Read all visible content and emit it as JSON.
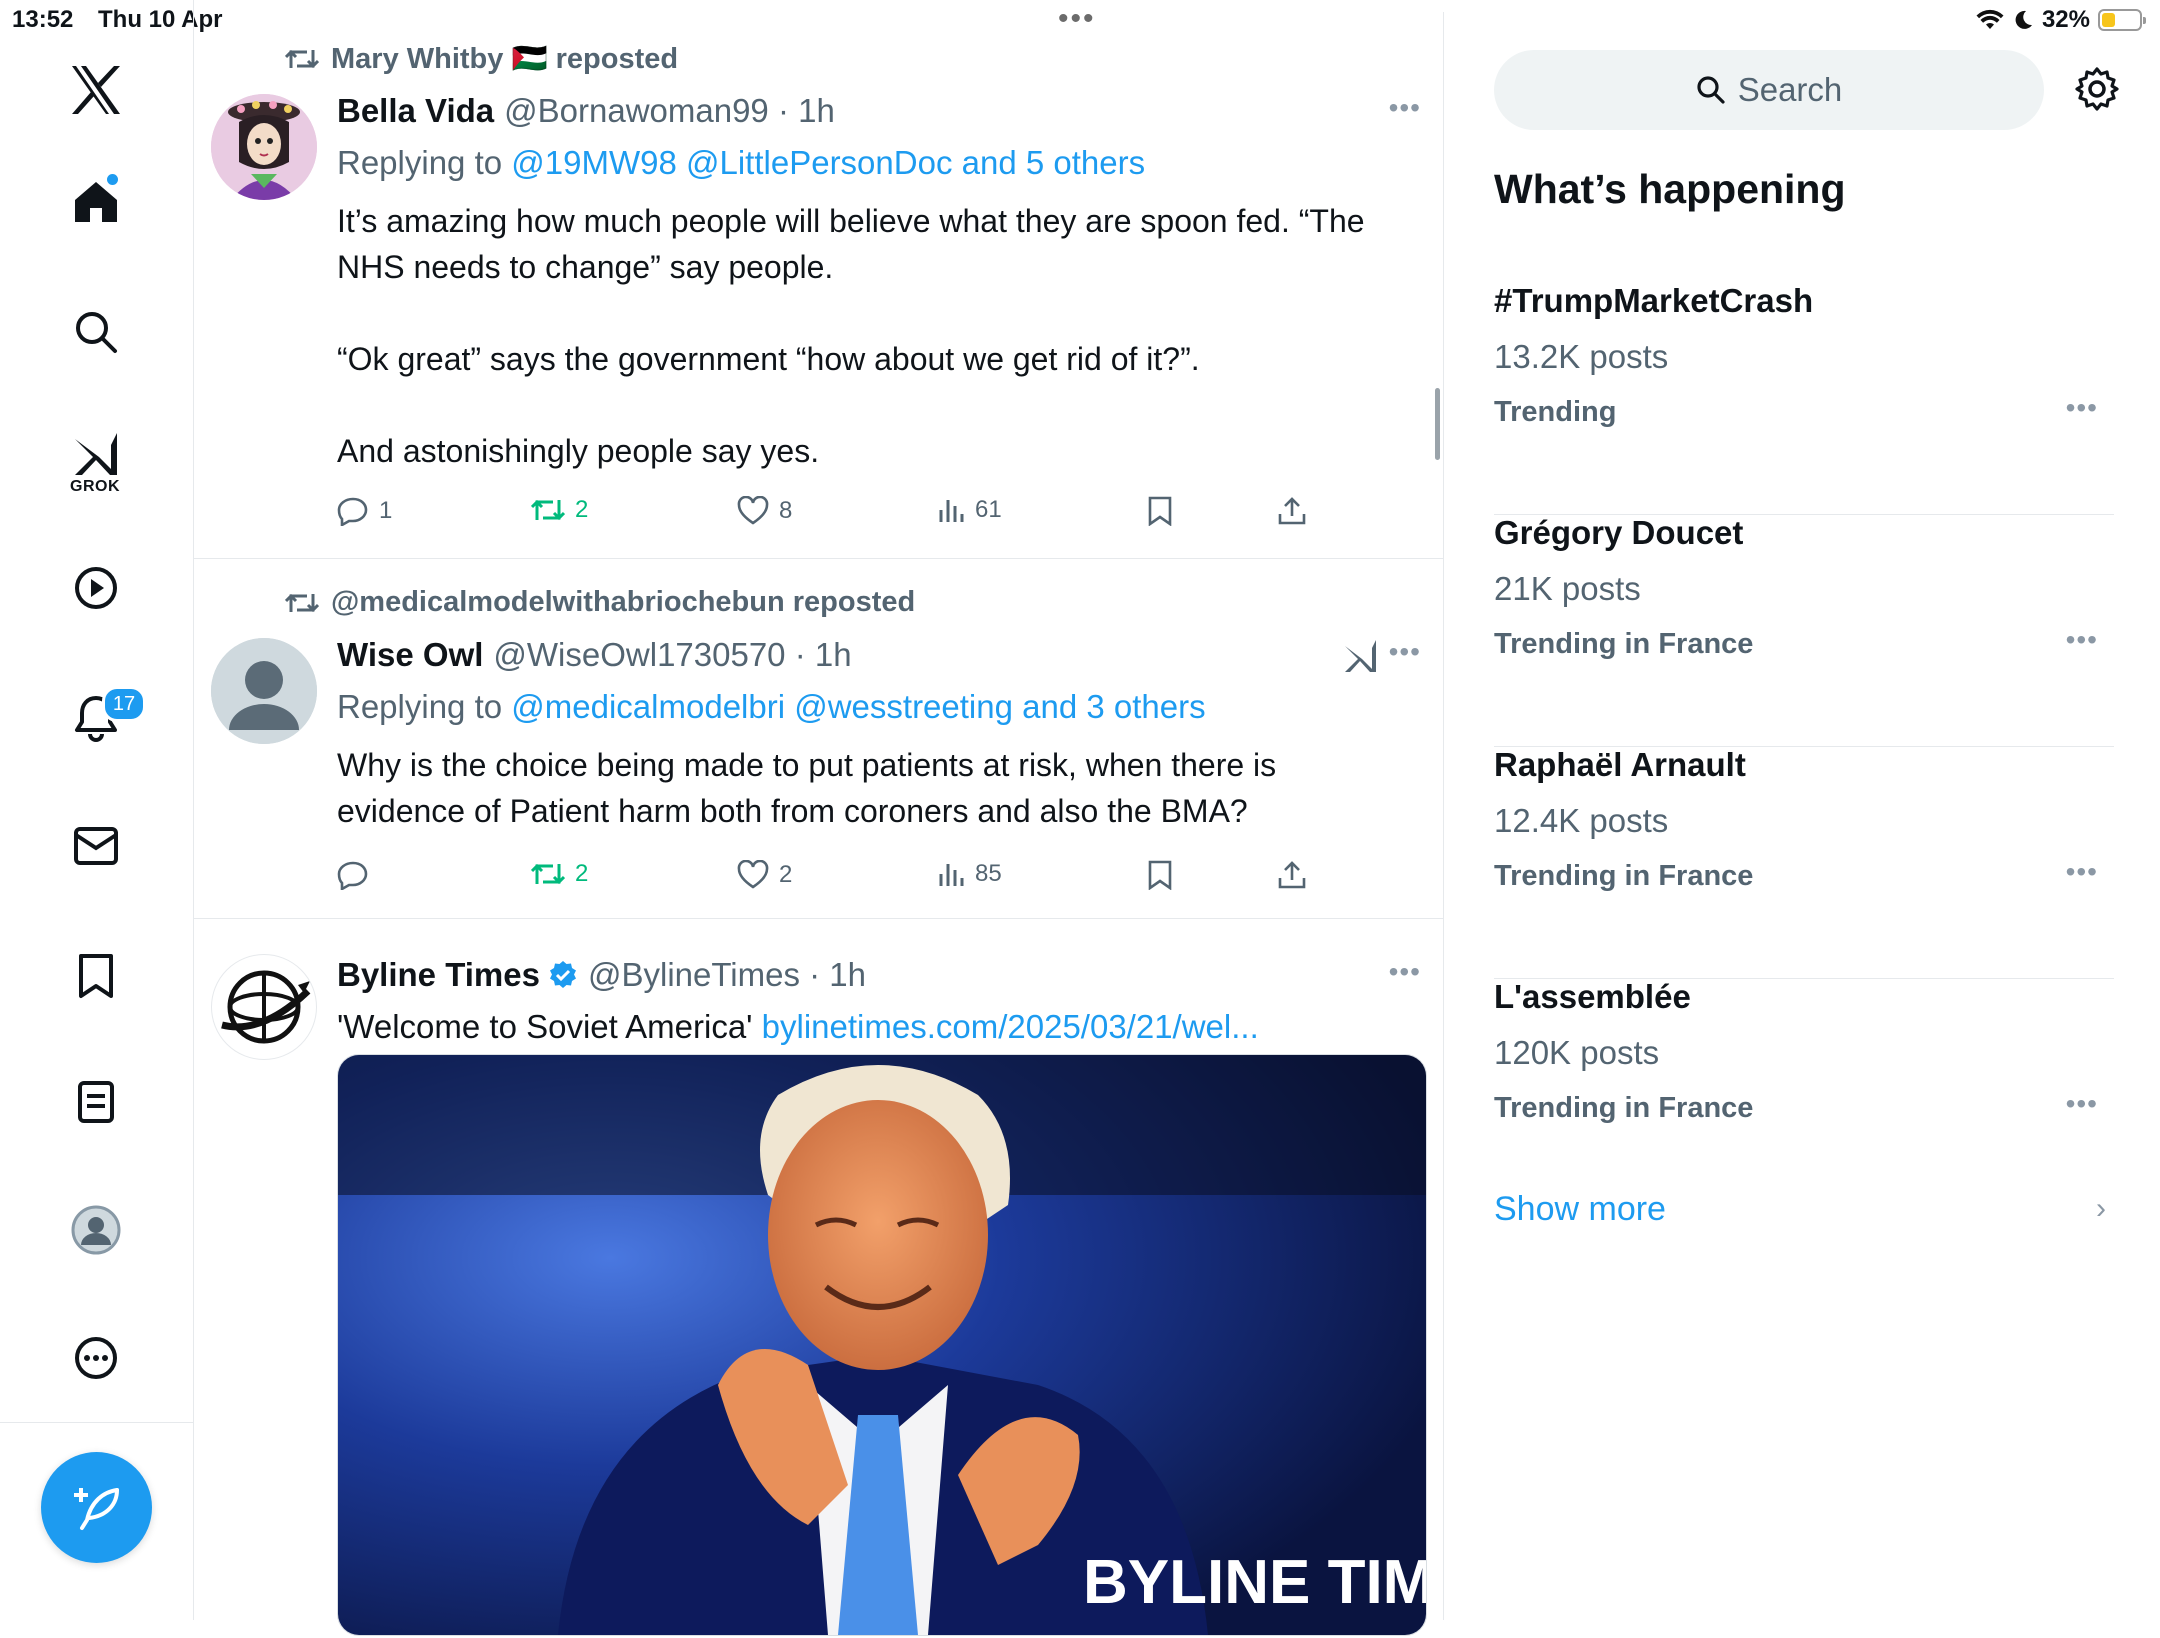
{
  "status_bar": {
    "time": "13:52",
    "date": "Thu 10 Apr",
    "battery": "32%",
    "battery_level": 0.32
  },
  "nav": {
    "grok_label": "GROK",
    "notifications_count": "17",
    "items": [
      "home",
      "explore",
      "grok",
      "videos",
      "notifications",
      "messages",
      "bookmarks",
      "lists",
      "profile",
      "more"
    ]
  },
  "posts": [
    {
      "reposted_by": "Mary Whitby 🇵🇸 reposted",
      "name": "Bella Vida",
      "handle": "@Bornawoman99 · 1h",
      "replying_prefix": "Replying to",
      "replying_to": "@19MW98 @LittlePersonDoc and 5 others",
      "body": [
        "It’s amazing how much people will believe what they are spoon fed. “The NHS needs to change” say people.",
        "“Ok great” says the government “how about we get rid of it?”.",
        "And astonishingly people say yes."
      ],
      "stats": {
        "replies": "1",
        "reposts": "2",
        "likes": "8",
        "views": "61"
      }
    },
    {
      "reposted_by": "@medicalmodelwithabriochebun reposted",
      "name": "Wise Owl",
      "handle": "@WiseOwl1730570 · 1h",
      "replying_prefix": "Replying to",
      "replying_to": "@medicalmodelbri @wesstreeting and 3 others",
      "body": [
        "Why is the choice being made to put patients at risk, when there is evidence of Patient harm both  from coroners and also the  BMA?"
      ],
      "stats": {
        "replies": "",
        "reposts": "2",
        "likes": "2",
        "views": "85"
      }
    },
    {
      "name": "Byline Times",
      "handle": "@BylineTimes · 1h",
      "body_text": "'Welcome to Soviet America'",
      "link": "bylinetimes.com/2025/03/21/wel...",
      "media_watermark": "BYLINE TIMES"
    }
  ],
  "sidebar": {
    "search_placeholder": "Search",
    "title": "What’s happening",
    "trends": [
      {
        "name": "#TrumpMarketCrash",
        "count": "13.2K posts",
        "context": "Trending"
      },
      {
        "name": "Grégory Doucet",
        "count": "21K posts",
        "context": "Trending in France"
      },
      {
        "name": "Raphaël Arnault",
        "count": "12.4K posts",
        "context": "Trending in France"
      },
      {
        "name": "L'assemblée",
        "count": "120K posts",
        "context": "Trending in France"
      }
    ],
    "show_more": "Show more"
  },
  "colors": {
    "accent": "#1d9bf0",
    "repost_green": "#00ba7c",
    "secondary_text": "#536471"
  }
}
